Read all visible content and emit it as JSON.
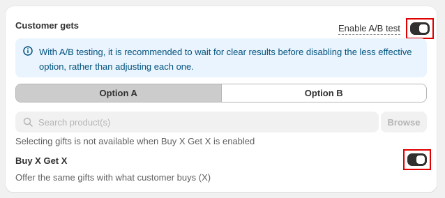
{
  "card": {
    "title": "Customer gets",
    "ab_test": {
      "label": "Enable A/B test",
      "enabled": true
    }
  },
  "banner": {
    "icon": "info-icon",
    "text": "With A/B testing, it is recommended to wait for clear results before disabling the less effective option, rather than adjusting each one."
  },
  "options": {
    "items": [
      "Option A",
      "Option B"
    ],
    "selected": "Option A"
  },
  "search": {
    "placeholder": "Search product(s)",
    "value": "",
    "browse_label": "Browse"
  },
  "note": "Selecting gifts is not available when Buy X Get X is enabled",
  "buy_x_get_x": {
    "title": "Buy X Get X",
    "description": "Offer the same gifts with what customer buys (X)",
    "enabled": true
  },
  "colors": {
    "toggle_on": "#303030",
    "highlight_border": "#e00000",
    "banner_bg": "#eaf4ff",
    "banner_text": "#00527c",
    "segment_active": "#cccccc"
  }
}
